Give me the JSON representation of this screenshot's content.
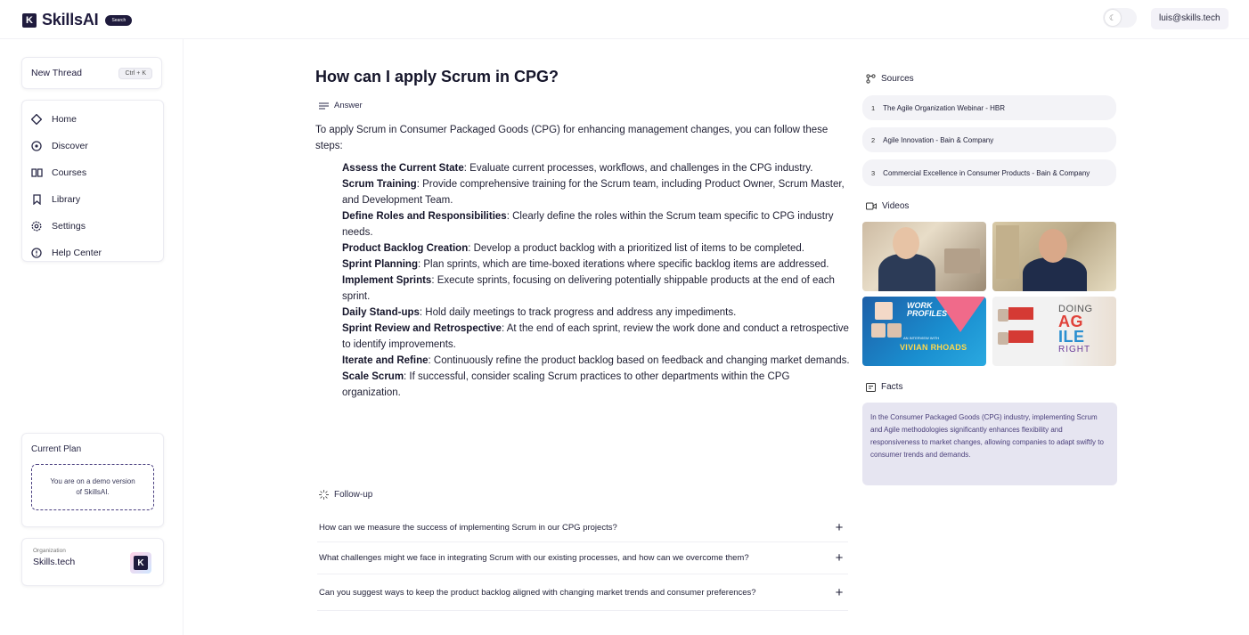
{
  "header": {
    "brand": "SkillsAI",
    "brand_badge": "Search",
    "user_email": "luis@skills.tech"
  },
  "sidebar": {
    "new_thread_label": "New Thread",
    "new_thread_shortcut": "Ctrl + K",
    "items": [
      {
        "label": "Home",
        "icon": "home-icon"
      },
      {
        "label": "Discover",
        "icon": "discover-icon"
      },
      {
        "label": "Courses",
        "icon": "book-icon"
      },
      {
        "label": "Library",
        "icon": "bookmark-icon"
      },
      {
        "label": "Settings",
        "icon": "gear-icon"
      },
      {
        "label": "Help Center",
        "icon": "help-icon"
      }
    ],
    "plan": {
      "title": "Current Plan",
      "text": "You are on a demo version of SkillsAI."
    },
    "org": {
      "label": "Organization",
      "name": "Skills.tech"
    }
  },
  "main": {
    "question": "How can I apply Scrum in CPG?",
    "answer_label": "Answer",
    "intro": "To apply Scrum in Consumer Packaged Goods (CPG) for enhancing management changes, you can follow these steps:",
    "steps": [
      {
        "title": "Assess the Current State",
        "text": ": Evaluate current processes, workflows, and challenges in the CPG industry."
      },
      {
        "title": "Scrum Training",
        "text": ": Provide comprehensive training for the Scrum team, including Product Owner, Scrum Master, and Development Team."
      },
      {
        "title": "Define Roles and Responsibilities",
        "text": ": Clearly define the roles within the Scrum team specific to CPG industry needs."
      },
      {
        "title": "Product Backlog Creation",
        "text": ": Develop a product backlog with a prioritized list of items to be completed."
      },
      {
        "title": "Sprint Planning",
        "text": ": Plan sprints, which are time-boxed iterations where specific backlog items are addressed."
      },
      {
        "title": "Implement Sprints",
        "text": ": Execute sprints, focusing on delivering potentially shippable products at the end of each sprint."
      },
      {
        "title": "Daily Stand-ups",
        "text": ": Hold daily meetings to track progress and address any impediments."
      },
      {
        "title": "Sprint Review and Retrospective",
        "text": ": At the end of each sprint, review the work done and conduct a retrospective to identify improvements."
      },
      {
        "title": "Iterate and Refine",
        "text": ": Continuously refine the product backlog based on feedback and changing market demands."
      },
      {
        "title": "Scale Scrum",
        "text": ": If successful, consider scaling Scrum practices to other departments within the CPG organization."
      }
    ],
    "followup_label": "Follow-up",
    "followups": [
      "How can we measure the success of implementing Scrum in our CPG projects?",
      "What challenges might we face in integrating Scrum with our existing processes, and how can we overcome them?",
      "Can you suggest ways to keep the product backlog aligned with changing market trends and consumer preferences?"
    ]
  },
  "right": {
    "sources_label": "Sources",
    "sources": [
      {
        "num": "1",
        "title": "The Agile Organization Webinar - HBR"
      },
      {
        "num": "2",
        "title": "Agile Innovation - Bain & Company"
      },
      {
        "num": "3",
        "title": "Commercial Excellence in Consumer Products - Bain & Company"
      }
    ],
    "videos_label": "Videos",
    "videos": {
      "v3_title": "WORK PROFILES",
      "v3_sub": "AN INTERVIEW WITH",
      "v3_name": "VIVIAN RHOADS",
      "v4_line1": "DOING",
      "v4_line2": "AG",
      "v4_line3": "ILE",
      "v4_line4": "RIGHT"
    },
    "facts_label": "Facts",
    "facts_text": "In the Consumer Packaged Goods (CPG) industry, implementing Scrum and Agile methodologies significantly enhances flexibility and responsiveness to market changes, allowing companies to adapt swiftly to consumer trends and demands."
  },
  "colors": {
    "brand": "#1f1b3d",
    "facts_bg": "#e6e5f1",
    "facts_text": "#4a3f7a"
  }
}
